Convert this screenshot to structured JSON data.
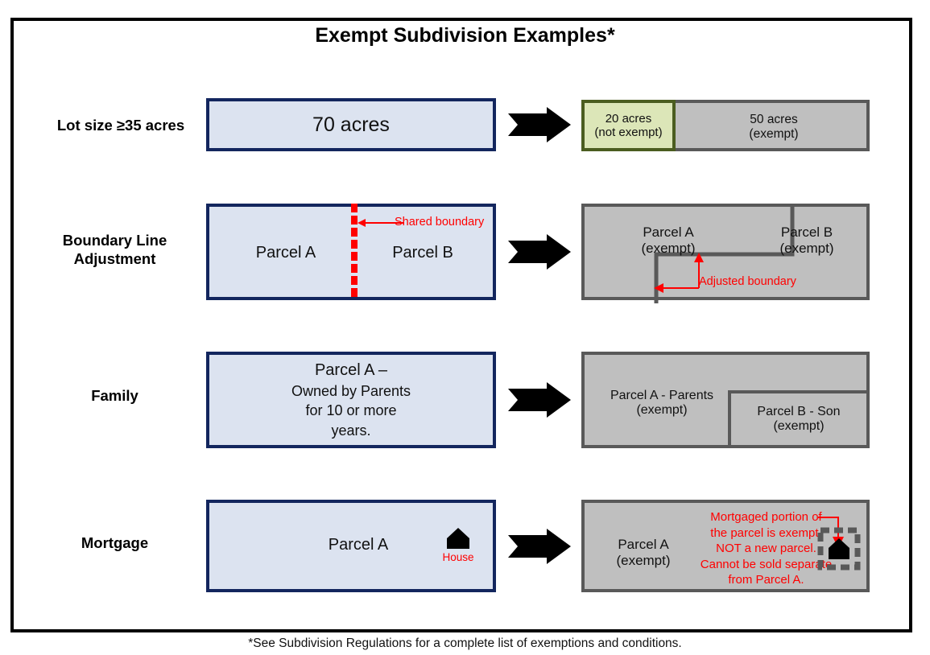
{
  "title": "Exempt Subdivision Examples*",
  "footnote": "*See Subdivision Regulations for a complete list of exemptions and conditions.",
  "colors": {
    "frame_border": "#000000",
    "blue_fill": "#dce3f0",
    "blue_border": "#13265e",
    "gray_fill": "#bfbfbf",
    "gray_border": "#595959",
    "green_fill": "#dce6b8",
    "green_border": "#4b5d20",
    "annotation_red": "#ff0000",
    "arrow_black": "#000000"
  },
  "rows": [
    {
      "label": "Lot size ≥35 acres",
      "before": {
        "text": "70 acres"
      },
      "after": {
        "parcels": [
          {
            "line1": "20 acres",
            "line2": "(not exempt)",
            "style": "green"
          },
          {
            "line1": "50 acres",
            "line2": "(exempt)",
            "style": "gray"
          }
        ]
      }
    },
    {
      "label_line1": "Boundary Line",
      "label_line2": "Adjustment",
      "before": {
        "parcel_left": "Parcel A",
        "parcel_right": "Parcel B",
        "annotation": "Shared boundary"
      },
      "after": {
        "parcel_a_line1": "Parcel A",
        "parcel_a_line2": "(exempt)",
        "parcel_b_line1": "Parcel B",
        "parcel_b_line2": "(exempt)",
        "annotation": "Adjusted boundary"
      }
    },
    {
      "label": "Family",
      "before": {
        "line1": "Parcel A –",
        "line2": "Owned by Parents",
        "line3": "for 10 or more",
        "line4": "years."
      },
      "after": {
        "parcel_a_line1": "Parcel A - Parents",
        "parcel_a_line2": "(exempt)",
        "parcel_b_line1": "Parcel B - Son",
        "parcel_b_line2": "(exempt)"
      }
    },
    {
      "label": "Mortgage",
      "before": {
        "text": "Parcel A",
        "house_label": "House"
      },
      "after": {
        "parcel_a_line1": "Parcel A",
        "parcel_a_line2": "(exempt)",
        "note_line1": "Mortgaged portion of",
        "note_line2": "the parcel is exempt.",
        "note_line3": "NOT a new parcel.",
        "note_line4": "Cannot be sold separate",
        "note_line5": "from Parcel A."
      }
    }
  ]
}
